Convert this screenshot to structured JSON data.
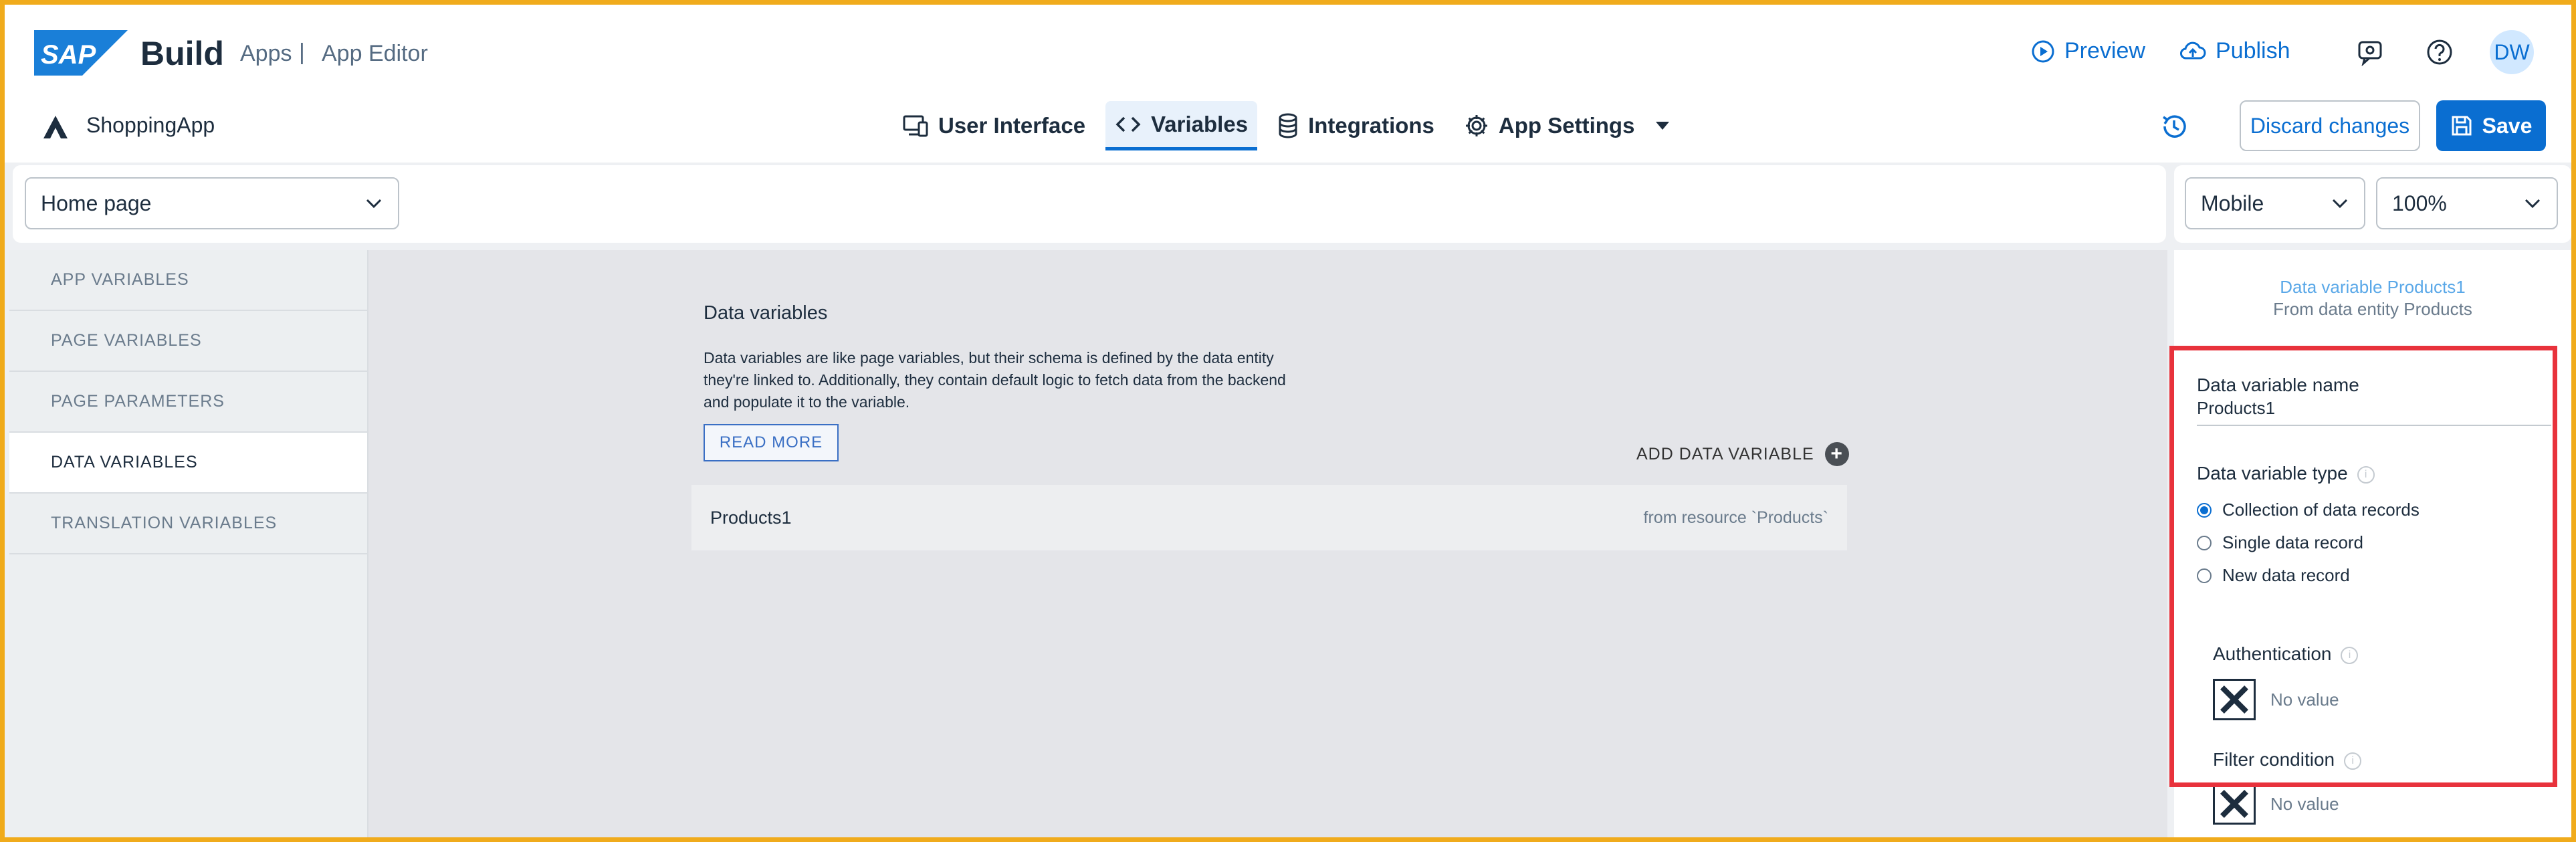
{
  "header": {
    "brand": "Build",
    "apps": "Apps",
    "separator": "|",
    "app_editor": "App Editor",
    "preview": "Preview",
    "publish": "Publish",
    "avatar_initials": "DW"
  },
  "app": {
    "name": "ShoppingApp"
  },
  "nav": {
    "tabs": [
      {
        "label": "User Interface",
        "icon": "devices-icon"
      },
      {
        "label": "Variables",
        "icon": "code-icon",
        "active": true
      },
      {
        "label": "Integrations",
        "icon": "database-icon"
      },
      {
        "label": "App Settings",
        "icon": "gear-icon"
      }
    ]
  },
  "actions": {
    "discard": "Discard changes",
    "save": "Save"
  },
  "toolbar": {
    "page_select": "Home page",
    "device_select": "Mobile",
    "zoom_select": "100%"
  },
  "sidebar": {
    "items": [
      {
        "label": "APP VARIABLES"
      },
      {
        "label": "PAGE VARIABLES"
      },
      {
        "label": "PAGE PARAMETERS"
      },
      {
        "label": "DATA VARIABLES",
        "active": true
      },
      {
        "label": "TRANSLATION VARIABLES"
      }
    ]
  },
  "main": {
    "title": "Data variables",
    "description": "Data variables are like page variables, but their schema is defined by the data entity they're linked to. Additionally, they contain default logic to fetch data from the backend and populate it to the variable.",
    "read_more": "READ MORE",
    "add_variable": "ADD DATA VARIABLE",
    "rows": [
      {
        "name": "Products1",
        "source": "from resource `Products`"
      }
    ]
  },
  "panel": {
    "heading": "Data variable Products1",
    "subheading": "From data entity Products",
    "name_label": "Data variable name",
    "name_value": "Products1",
    "type_label": "Data variable type",
    "type_options": [
      {
        "label": "Collection of data records",
        "selected": true
      },
      {
        "label": "Single data record",
        "selected": false
      },
      {
        "label": "New data record",
        "selected": false
      }
    ],
    "auth_label": "Authentication",
    "auth_value": "No value",
    "filter_label": "Filter condition",
    "filter_value": "No value"
  },
  "colors": {
    "accent": "#0a6ed1",
    "highlight": "#e8323c",
    "frame": "#f0ab1c"
  }
}
